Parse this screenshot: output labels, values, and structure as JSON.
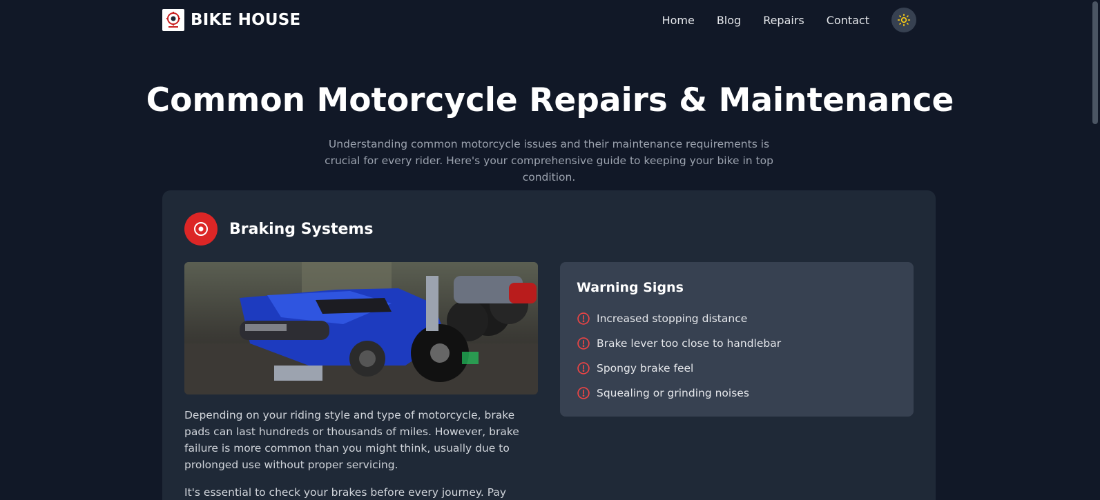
{
  "header": {
    "brand": "BIKE HOUSE",
    "nav": [
      "Home",
      "Blog",
      "Repairs",
      "Contact"
    ],
    "theme_icon": "sun-icon"
  },
  "hero": {
    "title": "Common Motorcycle Repairs & Maintenance",
    "subtitle": "Understanding common motorcycle issues and their maintenance requirements is crucial for every rider. Here's your comprehensive guide to keeping your bike in top condition."
  },
  "section": {
    "icon": "brake-disc-icon",
    "title": "Braking Systems",
    "paragraphs": [
      "Depending on your riding style and type of motorcycle, brake pads can last hundreds or thousands of miles. However, brake failure is more common than you might think, usually due to prolonged use without proper servicing.",
      "It's essential to check your brakes before every journey. Pay attention to"
    ],
    "warning": {
      "title": "Warning Signs",
      "items": [
        "Increased stopping distance",
        "Brake lever too close to handlebar",
        "Spongy brake feel",
        "Squealing or grinding noises"
      ]
    }
  },
  "colors": {
    "background": "#111827",
    "card": "#1f2937",
    "panel": "#374151",
    "accent": "#dc2626",
    "sun": "#facc15"
  }
}
